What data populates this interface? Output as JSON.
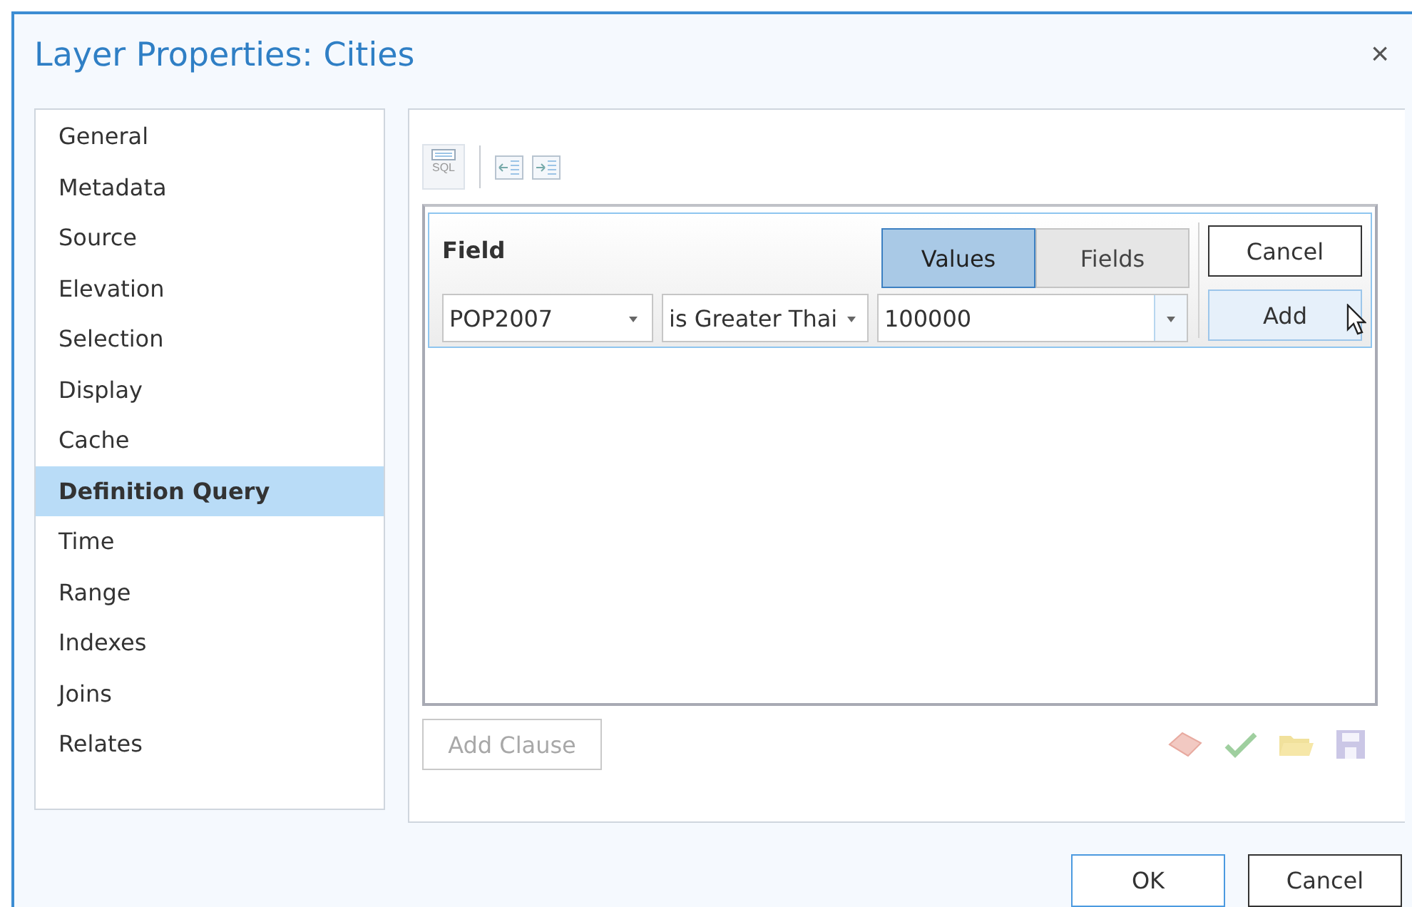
{
  "window": {
    "title": "Layer Properties: Cities",
    "close": "×"
  },
  "sidebar": {
    "items": [
      {
        "label": "General",
        "selected": false
      },
      {
        "label": "Metadata",
        "selected": false
      },
      {
        "label": "Source",
        "selected": false
      },
      {
        "label": "Elevation",
        "selected": false
      },
      {
        "label": "Selection",
        "selected": false
      },
      {
        "label": "Display",
        "selected": false
      },
      {
        "label": "Cache",
        "selected": false
      },
      {
        "label": "Definition Query",
        "selected": true
      },
      {
        "label": "Time",
        "selected": false
      },
      {
        "label": "Range",
        "selected": false
      },
      {
        "label": "Indexes",
        "selected": false
      },
      {
        "label": "Joins",
        "selected": false
      },
      {
        "label": "Relates",
        "selected": false
      }
    ]
  },
  "toolbar": {
    "sql_label": "SQL"
  },
  "clause": {
    "field_label": "Field",
    "modes": [
      {
        "label": "Values",
        "selected": true
      },
      {
        "label": "Fields",
        "selected": false
      }
    ],
    "field": "POP2007",
    "operator": "is Greater Thai",
    "value": "100000",
    "cancel": "Cancel",
    "add": "Add"
  },
  "add_clause": {
    "label": "Add Clause",
    "disabled": true
  },
  "footer": {
    "ok": "OK",
    "cancel": "Cancel"
  }
}
